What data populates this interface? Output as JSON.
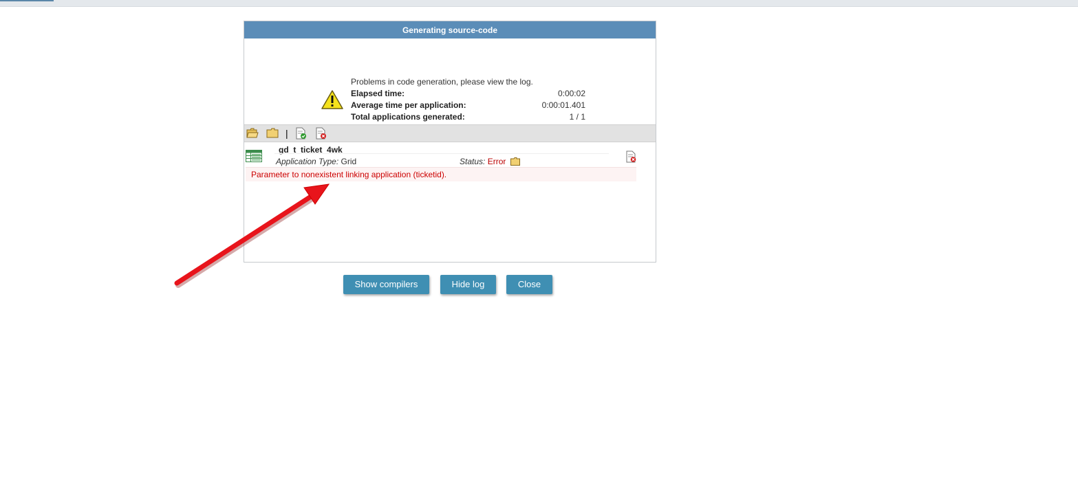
{
  "dialog": {
    "title": "Generating source-code",
    "message": "Problems in code generation, please view the log.",
    "stats": [
      {
        "label": "Elapsed time:",
        "value": "0:00:02"
      },
      {
        "label": "Average time per application:",
        "value": "0:00:01.401"
      },
      {
        "label": "Total applications generated:",
        "value": "1 / 1"
      }
    ],
    "icons": {
      "warning": "warning-icon",
      "toolbar": [
        "open-folder-icon",
        "folder-icon",
        "file-ok-icon",
        "file-error-icon"
      ]
    }
  },
  "log": {
    "app_name": "gd_t_ticket_4wk",
    "type_label": "Application Type:",
    "type_value": "Grid",
    "status_label": "Status:",
    "status_value": "Error",
    "error_message": "Parameter to nonexistent linking application (ticketid)."
  },
  "buttons": {
    "show_compilers": "Show compilers",
    "hide_log": "Hide log",
    "close": "Close"
  },
  "colors": {
    "title_bar": "#5b8db8",
    "button": "#3f8fb3",
    "error_text": "#cc0000",
    "annotation_arrow": "#e8141b"
  }
}
